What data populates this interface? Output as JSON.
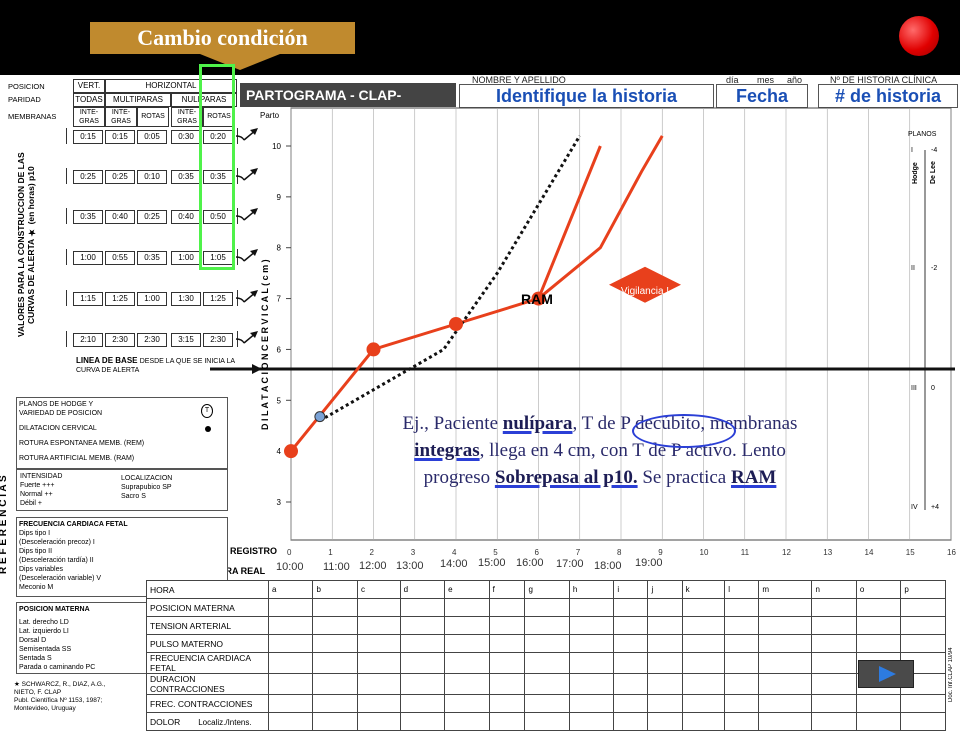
{
  "banner": {
    "title": "Cambio condición"
  },
  "form_header": {
    "nombre_label": "NOMBRE Y APELLIDO",
    "nombre_value": "Identifique la historia",
    "fecha_label": "Fecha",
    "dia_label": "día",
    "mes_label": "mes",
    "ano_label": "año",
    "historia_label": "Nº DE HISTORIA CLÍNICA",
    "historia_value": "# de historia",
    "partograma_title": "PARTOGRAMA - CLAP-OPS/OMS"
  },
  "left_table": {
    "row_labels": [
      "POSICION",
      "PARIDAD",
      "MEMBRANAS"
    ],
    "vert": "VERT.",
    "horizontal": "HORIZONTAL",
    "todas": "TODAS",
    "multiparas": "MULTIPARAS",
    "nuliparas": "NULIPARAS",
    "col_heads": [
      "INTE-\nGRAS",
      "INTE-\nGRAS",
      "ROTAS",
      "INTE-\nGRAS",
      "ROTAS"
    ],
    "values_rows": [
      [
        "0:15",
        "0:15",
        "0:05",
        "0:30",
        "0:20"
      ],
      [
        "0:25",
        "0:25",
        "0:10",
        "0:35",
        "0:35"
      ],
      [
        "0:35",
        "0:40",
        "0:25",
        "0:40",
        "0:50"
      ],
      [
        "1:00",
        "0:55",
        "0:35",
        "1:00",
        "1:05"
      ],
      [
        "1:15",
        "1:25",
        "1:00",
        "1:30",
        "1:25"
      ],
      [
        "2:10",
        "2:30",
        "2:30",
        "3:15",
        "2:30"
      ]
    ],
    "vertical_title": "VALORES PARA LA CONSTRUCCION DE LAS CURVAS DE ALERTA ★ (en horas) p10",
    "baseline_label": "LINEA DE BASE",
    "baseline_note": "DESDE LA QUE SE INICIA LA CURVA DE ALERTA"
  },
  "chart_axes": {
    "parto_label": "Parto",
    "y_axis_title": "D I L A T A C I O N   C E R V I C A L   ( c m )",
    "planos_title": "PLANOS",
    "hodge": "Hodge",
    "de_lee": "De Lee",
    "planos_rows": [
      {
        "hodge": "I",
        "delee": "-4"
      },
      {
        "hodge": "II",
        "delee": "-2"
      },
      {
        "hodge": "III",
        "delee": "0"
      },
      {
        "hodge": "IV",
        "delee": "+4"
      }
    ],
    "horas_registro_label": "HORAS DE REGISTRO",
    "hora_real_label": "HORA REAL",
    "hour_ticks": [
      "0",
      "1",
      "2",
      "3",
      "4",
      "5",
      "6",
      "7",
      "8",
      "9",
      "10",
      "11",
      "12",
      "13",
      "14",
      "15",
      "16"
    ],
    "real_times": [
      "10:00",
      "11:00",
      "12:00",
      "13:00",
      "14:00",
      "15:00",
      "16:00",
      "17:00",
      "18:00",
      "19:00"
    ]
  },
  "chart_data": {
    "type": "line",
    "xlabel": "HORAS DE REGISTRO",
    "ylabel": "DILATACION CERVICAL (cm)",
    "ylim": [
      0,
      10
    ],
    "xlim": [
      0,
      16
    ],
    "series": [
      {
        "values": [
          [
            0,
            4
          ],
          [
            2,
            6
          ],
          [
            4,
            6.5
          ],
          [
            6,
            7
          ],
          [
            7.5,
            10
          ]
        ]
      },
      {
        "values": [
          [
            6,
            7
          ],
          [
            7.5,
            8
          ],
          [
            8.5,
            9.5
          ],
          [
            9,
            10.2
          ]
        ]
      },
      {
        "values": [
          [
            0.7,
            4.6
          ],
          [
            3.7,
            6
          ],
          [
            5,
            7.5
          ],
          [
            7,
            10.2
          ]
        ]
      }
    ],
    "annotations": [
      "RAM",
      "Vigilancia !"
    ]
  },
  "references": {
    "vertical_title": "R E F E R E N C I A S",
    "planos_box": {
      "lines": [
        "PLANOS DE HODGE Y",
        "VARIEDAD DE POSICION",
        "DILATACION CERVICAL",
        "ROTURA ESPONTANEA MEMB. (REM)",
        "ROTURA ARTIFICIAL MEMB. (RAM)"
      ]
    },
    "intensidad_box": {
      "title": "INTENSIDAD",
      "lines": [
        "Fuerte +++",
        "Normal ++",
        "Débil +"
      ],
      "localizacion": "LOCALIZACION",
      "loc_lines": [
        "Suprapubico SP",
        "Sacro S"
      ]
    },
    "fcf_box": {
      "title": "FRECUENCIA CARDIACA FETAL",
      "lines": [
        "Dips tipo I",
        "(Desceleración precoz) I",
        "Dips tipo II",
        "(Desceleración tardía) II",
        "Dips variables",
        "(Desceleración variable) V",
        "Meconio M"
      ]
    },
    "posicion_box": {
      "title": "POSICION MATERNA",
      "lines": [
        "Lat. derecho LD",
        "Lat. izquierdo LI",
        "Dorsal D",
        "Semisentada SS",
        "Sentada S",
        "Parada o caminando PC"
      ]
    },
    "citation": [
      "★ SCHWARCZ, R., DIAZ, A.G.,",
      "NIETO, F. CLAP",
      "Publ. Científica Nº 1153, 1987;",
      "Montevideo, Uruguay"
    ]
  },
  "bottom_table": {
    "rows": [
      "HORA",
      "POSICION MATERNA",
      "TENSION ARTERIAL",
      "PULSO MATERNO",
      "FRECUENCIA CARDIACA FETAL",
      "DURACION CONTRACCIONES",
      "FREC. CONTRACCIONES",
      "DOLOR"
    ],
    "dolor_sub": "Localiz./Intens.",
    "letters": [
      "a",
      "b",
      "c",
      "d",
      "e",
      "f",
      "g",
      "h",
      "i",
      "j",
      "k",
      "l",
      "m",
      "n",
      "o",
      "p"
    ]
  },
  "annotation": {
    "line1_a": "Ej., Paciente ",
    "nulipara": "nulípara",
    "line1_b": ", T de P decúbito, membranas",
    "integras": "integras",
    "line2": ", llega en 4 cm, con T de P activo. Lento",
    "line3_a": "progreso ",
    "sobrepasa": "Sobrepasa al p10.",
    "line3_b": " Se practica ",
    "ram": "RAM"
  },
  "side_code": "Doc. Inf.CLAP 10/94",
  "colors": {
    "accent": "#e8401c",
    "highlight": "#4ff24a",
    "banner": "#c08a2e",
    "ink_blue": "#1a4fb5"
  }
}
